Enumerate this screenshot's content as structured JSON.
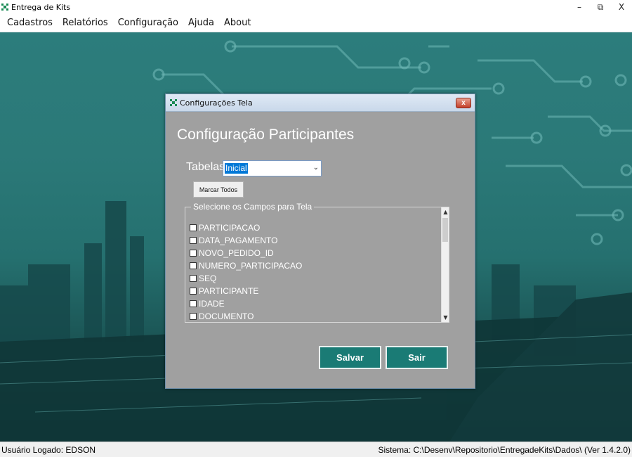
{
  "app": {
    "title": "Entrega de Kits",
    "controls": {
      "minimize": "–",
      "restore": "⧉",
      "close": "X"
    }
  },
  "menu": {
    "items": [
      "Cadastros",
      "Relatórios",
      "Configuração",
      "Ajuda",
      "About"
    ]
  },
  "dialog": {
    "title": "Configurações Tela",
    "close": "x",
    "heading": "Configuração Participantes",
    "tabelas_label": "Tabelas",
    "tabelas_value": "Inicial",
    "marcar_todos": "Marcar Todos",
    "group_label": "Selecione os Campos para Tela",
    "fields": [
      "PARTICIPACAO",
      "DATA_PAGAMENTO",
      "NOVO_PEDIDO_ID",
      "NUMERO_PARTICIPACAO",
      "SEQ",
      "PARTICIPANTE",
      "IDADE",
      "DOCUMENTO"
    ],
    "salvar": "Salvar",
    "sair": "Sair"
  },
  "status": {
    "user": "Usuário Logado: EDSON",
    "system": "Sistema: C:\\Desenv\\Repositorio\\EntregadeKits\\Dados\\ (Ver 1.4.2.0)"
  },
  "colors": {
    "accent_button": "#1a7b75",
    "desktop": "#2c7d7c",
    "dialog_bg": "#a0a0a0"
  }
}
